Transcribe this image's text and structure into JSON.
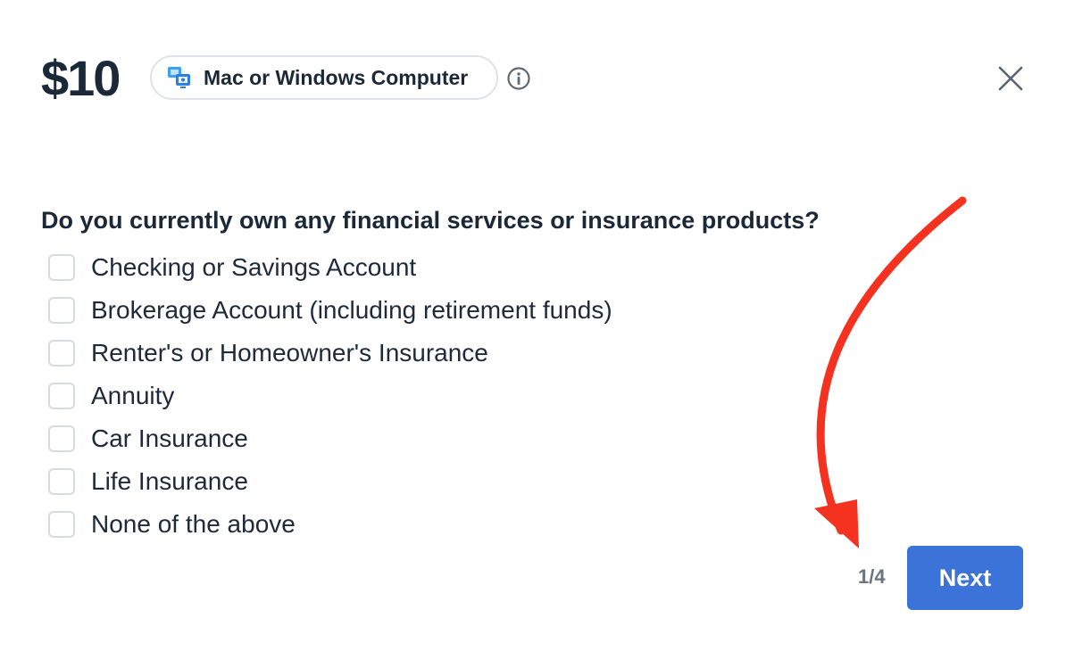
{
  "header": {
    "price": "$10",
    "device_label": "Mac or Windows Computer",
    "device_icon": "computer-icon",
    "info_icon": "info-icon",
    "close_icon": "close-icon"
  },
  "survey": {
    "question": "Do you currently own any financial services or insurance products?",
    "options": [
      {
        "label": "Checking or Savings Account",
        "checked": false
      },
      {
        "label": "Brokerage Account (including retirement funds)",
        "checked": false
      },
      {
        "label": "Renter's or Homeowner's Insurance",
        "checked": false
      },
      {
        "label": "Annuity",
        "checked": false
      },
      {
        "label": "Car Insurance",
        "checked": false
      },
      {
        "label": "Life Insurance",
        "checked": false
      },
      {
        "label": "None of the above",
        "checked": false
      }
    ]
  },
  "footer": {
    "step": "1/4",
    "next_label": "Next"
  },
  "annotation": {
    "arrow_color": "#f5311f"
  },
  "colors": {
    "accent": "#3b73d8",
    "text": "#1b2838",
    "muted": "#6b7480"
  }
}
